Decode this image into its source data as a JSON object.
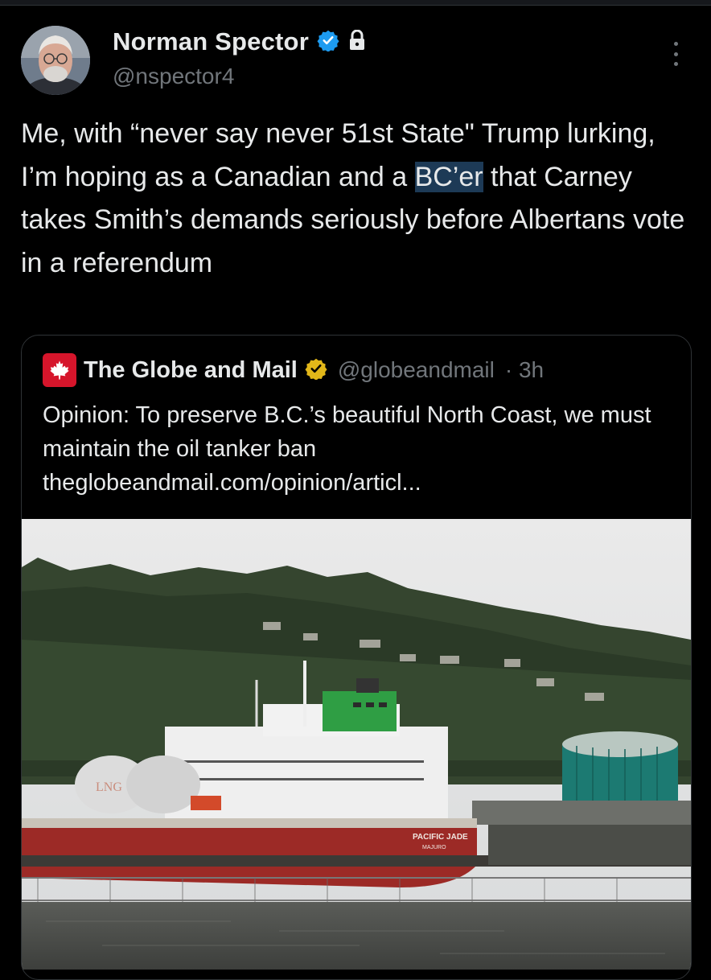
{
  "author": {
    "name": "Norman Spector",
    "handle": "@nspector4",
    "verified": true,
    "protected": true
  },
  "tweet": {
    "text_before": "Me, with “never say never 51st State\" Trump lurking, I’m hoping as a Canadian and a ",
    "highlighted": "BC’er",
    "text_after": " that Carney takes Smith’s demands seriously before Albertans vote in a referendum"
  },
  "quoted": {
    "name": "The Globe and Mail",
    "handle": "@globeandmail",
    "time": "· 3h",
    "text": "Opinion: To preserve B.C.’s beautiful North Coast, we must maintain the oil tanker ban",
    "link": "theglobeandmail.com/opinion/articl...",
    "image": {
      "ship_hull_text": "PACIFIC JADE",
      "ship_port_text": "MAJURO",
      "tank_text": "LNG"
    }
  },
  "colors": {
    "background": "#000000",
    "text": "#e7e9ea",
    "secondary": "#71767b",
    "verified_blue": "#1d9bf0",
    "verified_gold": "#e2b719",
    "globe_red": "#d6152b",
    "highlight": "#1d3a56"
  },
  "icons": [
    "verified-badge-icon",
    "lock-icon",
    "more-options-icon",
    "maple-leaf-icon",
    "gold-verified-badge-icon"
  ]
}
